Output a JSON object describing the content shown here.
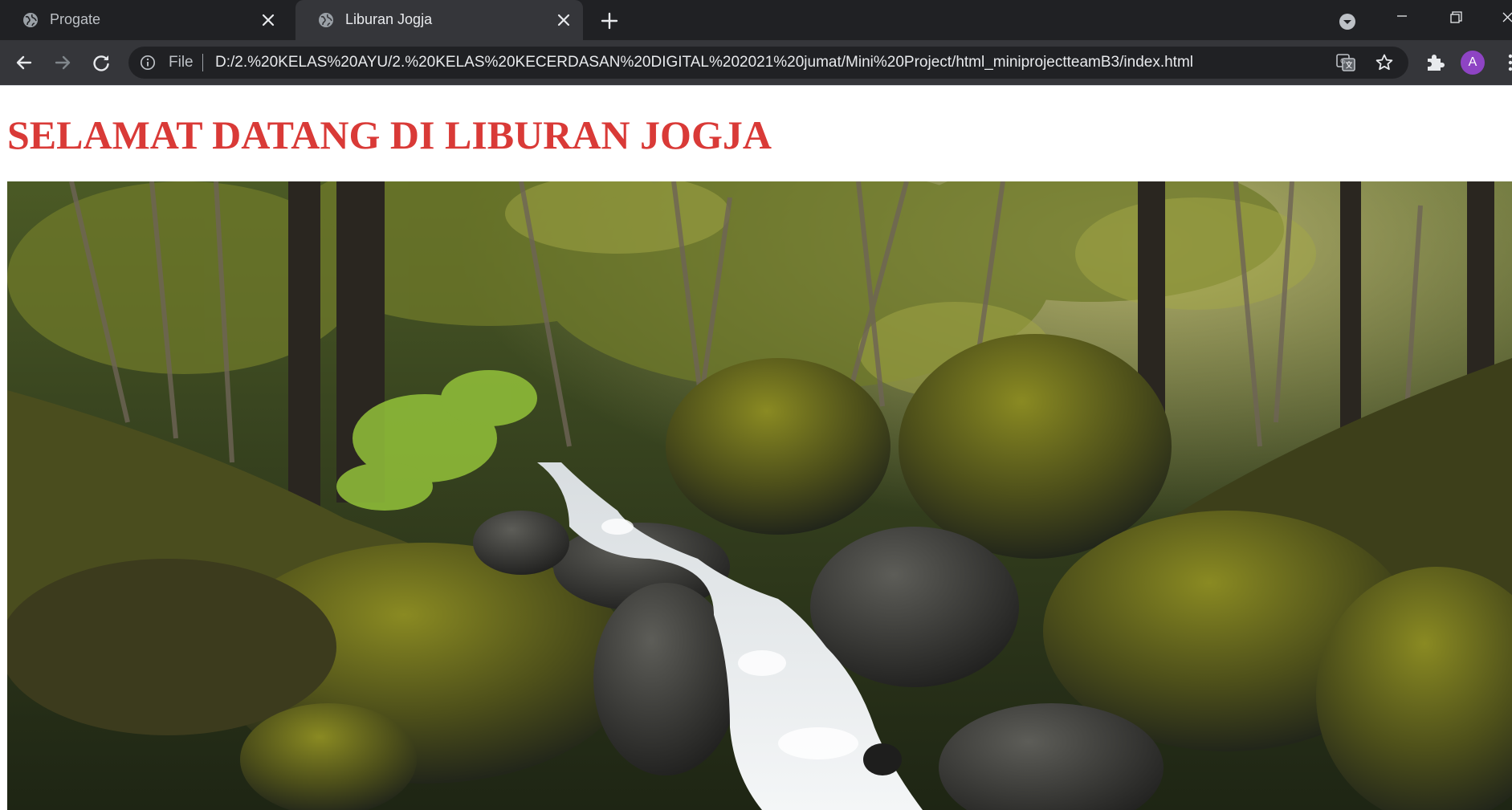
{
  "browser": {
    "tabs": [
      {
        "title": "Progate",
        "active": false
      },
      {
        "title": "Liburan Jogja",
        "active": true
      }
    ],
    "address_bar": {
      "scheme_label": "File",
      "url": "D:/2.%20KELAS%20AYU/2.%20KELAS%20KECERDASAN%20DIGITAL%202021%20jumat/Mini%20Project/html_miniprojectteamB3/index.html"
    },
    "profile_initial": "A",
    "icons": {
      "tab_favicon": "globe-icon",
      "tab_close": "close-icon",
      "new_tab": "plus-icon",
      "tab_search": "tab-search-icon",
      "back": "arrow-left-icon",
      "forward": "arrow-right-icon",
      "reload": "reload-icon",
      "site_info": "info-icon",
      "translate": "translate-icon",
      "bookmark": "star-icon",
      "extensions": "puzzle-icon",
      "menu": "kebab-menu-icon"
    },
    "colors": {
      "tabstrip": "#202124",
      "toolbar": "#35363a",
      "omnibox": "#202124",
      "avatar": "#8e44c4"
    }
  },
  "page": {
    "heading": "SELAMAT DATANG DI LIBURAN JOGJA",
    "heading_color": "#d93a37",
    "hero_image": "forest stream with mossy rocks"
  }
}
